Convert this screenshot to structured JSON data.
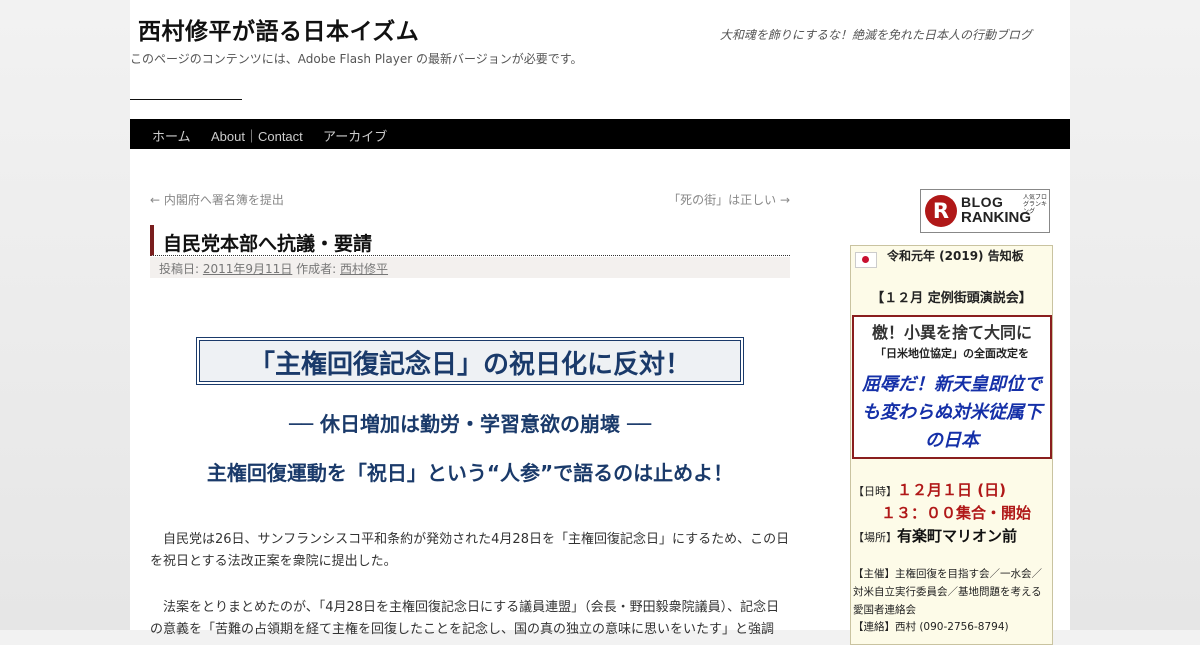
{
  "header": {
    "site_title": "西村修平が語る日本イズム",
    "site_description": "大和魂を飾りにするな！絶滅を免れた日本人の行動ブログ",
    "flash_notice": "このページのコンテンツには、Adobe Flash Player の最新バージョンが必要です。"
  },
  "nav": {
    "items": [
      {
        "label": "ホーム"
      },
      {
        "label": "About｜Contact"
      },
      {
        "label": "アーカイブ"
      }
    ]
  },
  "post_nav": {
    "prev": "← 内閣府へ署名簿を提出",
    "next": "「死の街」は正しい →"
  },
  "post": {
    "title": "自民党本部へ抗議・要請",
    "meta_posted": "投稿日:",
    "meta_date": "2011年9月11日",
    "meta_author_label": "作成者:",
    "meta_author": "西村修平",
    "box_headline": "「主権回復記念日」の祝日化に反対！",
    "subhead1": "── 休日増加は勤労・学習意欲の崩壊 ──",
    "subhead2": "主権回復運動を「祝日」という“人参”で語るのは止めよ！",
    "para1": "　自民党は26日、サンフランシスコ平和条約が発効された4月28日を「主権回復記念日」にするため、この日を祝日とする法改正案を衆院に提出した。",
    "para2": "　法案をとりまとめたのが、「4月28日を主権回復記念日にする議員連盟」（会長・野田毅衆院議員）、記念日の意義を「苦難の占領期を経て主権を回復したことを記念し、国の真の独立の意味に思いをいたす」と強調"
  },
  "sidebar": {
    "ranking_banner": {
      "icon_letter": "R",
      "word1": "BLOG",
      "word2": "RANKING",
      "small_text": "人気ブログランキング"
    },
    "notice": {
      "flag_icon": "japan-flag-icon",
      "heading": "令和元年 (2019) 告知板",
      "event_title": "【１２月 定例街頭演説会】",
      "slogan1": "檄！小異を捨て大同に",
      "slogan2": "「日米地位協定」の全面改定を",
      "slogan3": "屈辱だ！新天皇即位でも変わらぬ対米従属下の日本",
      "date_label": "【日時】",
      "date_value": "１２月１日 (日)",
      "time_value": "１３：００集合・開始",
      "place_label": "【場所】",
      "place_value": "有楽町マリオン前",
      "organizer": "【主催】主権回復を目指す会／一水会／対米自立実行委員会／基地問題を考える愛国者連絡会",
      "contact": "【連絡】西村 (090-2756-8794)"
    }
  },
  "colors": {
    "accent_blue": "#1a3a6a",
    "accent_red": "#b01818",
    "menu_bg": "#000000"
  }
}
